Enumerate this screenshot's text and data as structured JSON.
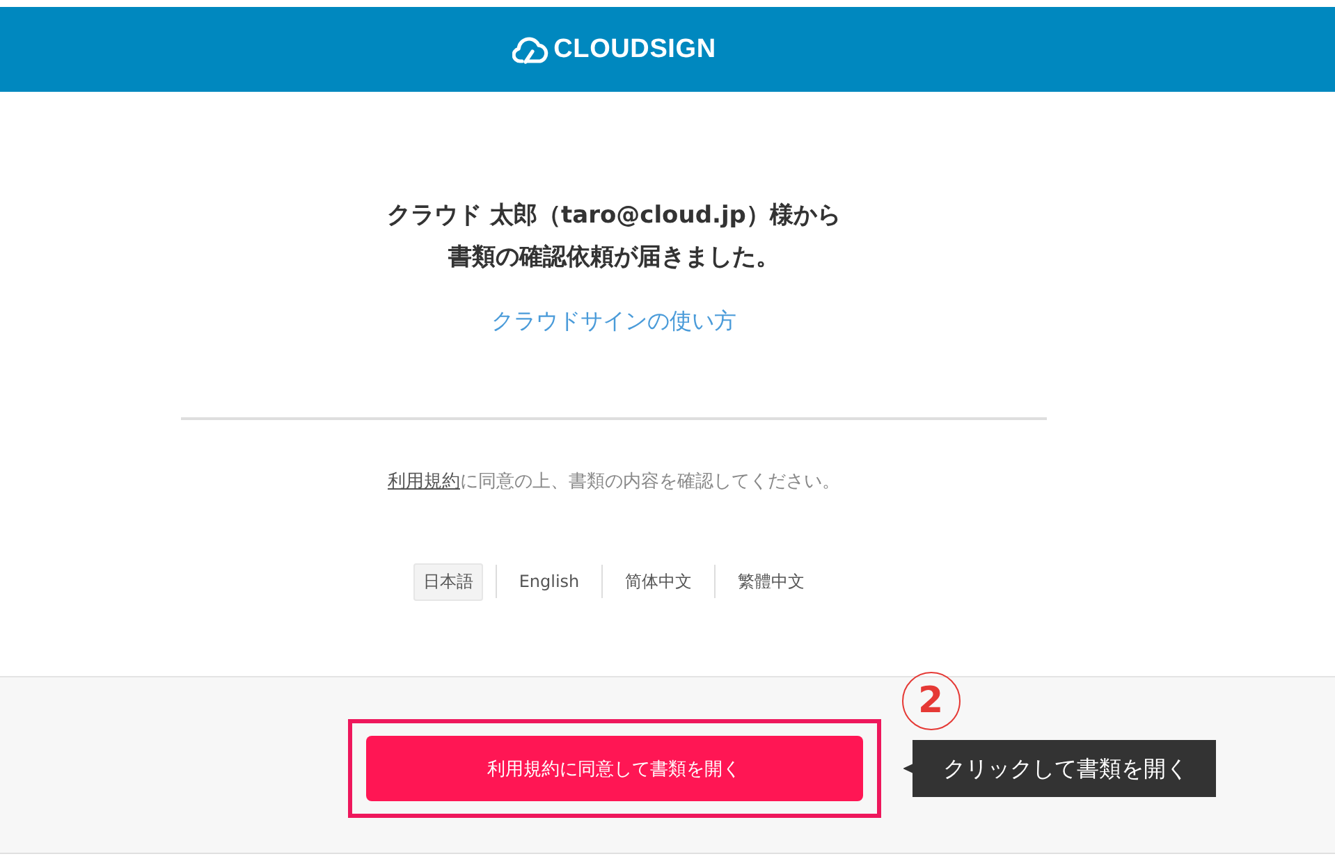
{
  "header": {
    "logo_text": "CLOUDSIGN"
  },
  "message": {
    "lines": [
      "クラウド 太郎（taro@cloud.jp）様から",
      "書類の確認依頼が届きました。"
    ],
    "help_link": "クラウドサインの使い方"
  },
  "terms": {
    "link": "利用規約",
    "text": "に同意の上、書類の内容を確認してください。"
  },
  "languages": [
    {
      "label": "日本語",
      "selected": true
    },
    {
      "label": "English",
      "selected": false
    },
    {
      "label": "简体中文",
      "selected": false
    },
    {
      "label": "繁體中文",
      "selected": false
    }
  ],
  "footer": {
    "button": "利用規約に同意して書類を開く",
    "highlighted": true
  },
  "annotation": {
    "step": "2",
    "callout": "クリックして書類を開く"
  }
}
